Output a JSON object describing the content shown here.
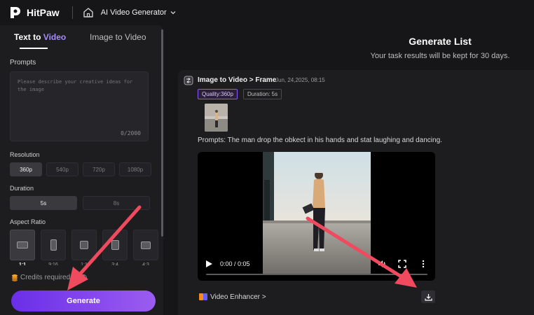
{
  "topbar": {
    "brand": "HitPaw",
    "nav_title": "AI Video Generator",
    "icons": [
      "hitpaw-logo-icon",
      "home-icon",
      "chevron-down-icon"
    ]
  },
  "left_panel": {
    "tabs": [
      {
        "label_prefix": "Text to ",
        "label_accent": "Video",
        "active": true
      },
      {
        "label": "Image to Video",
        "active": false
      }
    ],
    "prompts_label": "Prompts",
    "prompt_placeholder": "Please describe your creative ideas for the image",
    "char_count": "0/2000",
    "resolution_label": "Resolution",
    "resolutions": [
      "360p",
      "540p",
      "720p",
      "1080p"
    ],
    "resolution_selected": "360p",
    "duration_label": "Duration",
    "durations": [
      "5s",
      "8s"
    ],
    "duration_selected": "5s",
    "aspect_label": "Aspect Ratio",
    "aspect_ratios": [
      "1:1",
      "9:16",
      "1:1",
      "3:4",
      "4:3"
    ],
    "aspect_selected_index": 0,
    "credits_text": "Credits required: 0",
    "generate_label": "Generate"
  },
  "generate_list": {
    "title": "Generate List",
    "subtitle": "Your task results will be kept for 30 days.",
    "task": {
      "title": "Image to Video > Frame",
      "date": "Jun, 24,2025, 08:15",
      "quality_badge": "Quality:360p",
      "duration_badge": "Duration: 5s",
      "prompt_text": "Prompts:  The man drop the obkect in his hands and stat laughing and dancing.",
      "player": {
        "time": "0:00 / 0:05",
        "progress": 0
      },
      "enhancer_label": "Video Enhancer >"
    }
  },
  "colors": {
    "accent": "#a78bfa",
    "generate_gradient_start": "#6a2ee8",
    "generate_gradient_end": "#9b5cf0",
    "annotation_arrow": "#ef4a5e"
  }
}
